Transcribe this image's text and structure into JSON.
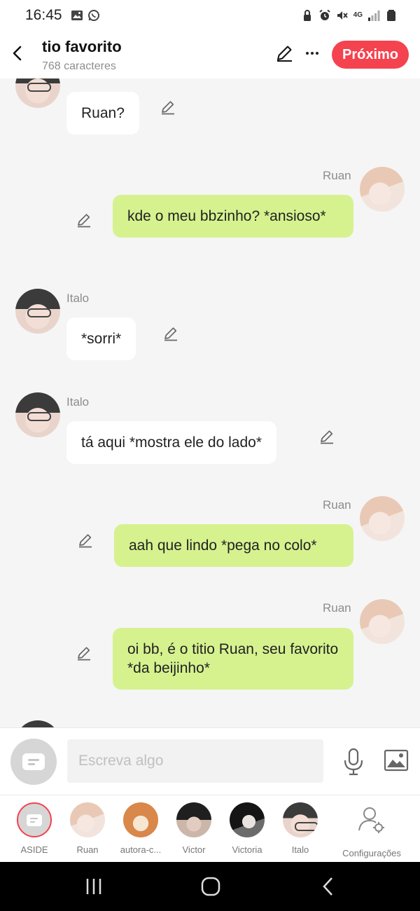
{
  "status_bar": {
    "time": "16:45",
    "left_icons": [
      "gallery-icon",
      "whatsapp-icon"
    ],
    "right_icons": [
      "lock-icon",
      "alarm-icon",
      "mute-icon",
      "4g-icon",
      "signal-icon",
      "battery-icon"
    ],
    "network_label": "4G"
  },
  "header": {
    "title": "tio favorito",
    "char_count": "768 caracteres",
    "next_label": "Próximo",
    "accent_color": "#f5424f"
  },
  "chat": {
    "messages": [
      {
        "speaker": "",
        "side": "left",
        "text": "Ruan?"
      },
      {
        "speaker": "Ruan",
        "side": "right",
        "text": "kde o meu bbzinho? *ansioso*"
      },
      {
        "speaker": "Italo",
        "side": "left",
        "text": "*sorri*"
      },
      {
        "speaker": "Italo",
        "side": "left",
        "text": "tá aqui *mostra ele do lado*"
      },
      {
        "speaker": "Ruan",
        "side": "right",
        "text": "aah que lindo *pega no colo*"
      },
      {
        "speaker": "Ruan",
        "side": "right",
        "text": "oi bb, é o titio Ruan, seu favorito *da beijinho*"
      }
    ],
    "bubble_colors": {
      "left": "#ffffff",
      "right": "#d6f28f"
    }
  },
  "composer": {
    "placeholder": "Escreva algo",
    "value": ""
  },
  "characters": [
    {
      "label": "ASIDE",
      "selected": true
    },
    {
      "label": "Ruan"
    },
    {
      "label": "autora-c..."
    },
    {
      "label": "Victor"
    },
    {
      "label": "Victoria"
    },
    {
      "label": "Italo"
    },
    {
      "label": "Configurações"
    }
  ]
}
